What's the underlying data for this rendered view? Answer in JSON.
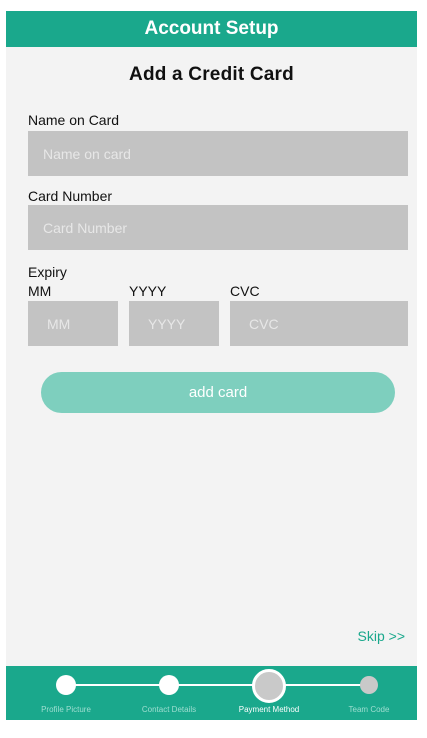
{
  "header": {
    "title": "Account Setup"
  },
  "page_title": "Add a Credit Card",
  "form": {
    "name_label": "Name on Card",
    "name_placeholder": "Name on card",
    "name_value": "",
    "number_label": "Card Number",
    "number_placeholder": "Card Number",
    "number_value": "",
    "expiry_label": "Expiry",
    "month_label": "MM",
    "month_placeholder": "MM",
    "year_label": "YYYY",
    "year_placeholder": "YYYY",
    "cvc_label": "CVC",
    "cvc_placeholder": "CVC"
  },
  "actions": {
    "add_card_label": "add card",
    "skip_label": "Skip >>"
  },
  "progress": {
    "steps": [
      {
        "label": "Profile Picture",
        "state": "done"
      },
      {
        "label": "Contact Details",
        "state": "done"
      },
      {
        "label": "Payment Method",
        "state": "current"
      },
      {
        "label": "Team Code",
        "state": "upcoming"
      }
    ]
  },
  "colors": {
    "accent": "#1aa88c",
    "button_disabled": "#7ecfbe",
    "field_background": "#c3c3c3",
    "screen_background": "#f3f3f3"
  }
}
